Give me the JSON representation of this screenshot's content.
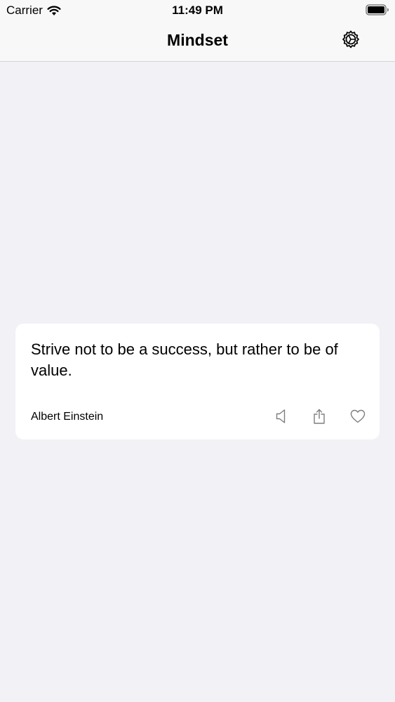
{
  "status_bar": {
    "carrier": "Carrier",
    "time": "11:49 PM"
  },
  "nav": {
    "title": "Mindset",
    "settings_icon": "gear-icon"
  },
  "quote": {
    "text": "Strive not to be a success, but rather to be of value.",
    "author": "Albert Einstein",
    "actions": [
      "speaker-icon",
      "share-icon",
      "heart-icon"
    ]
  },
  "colors": {
    "background": "#f2f1f6",
    "card": "#ffffff",
    "icon": "#7d7d80"
  }
}
